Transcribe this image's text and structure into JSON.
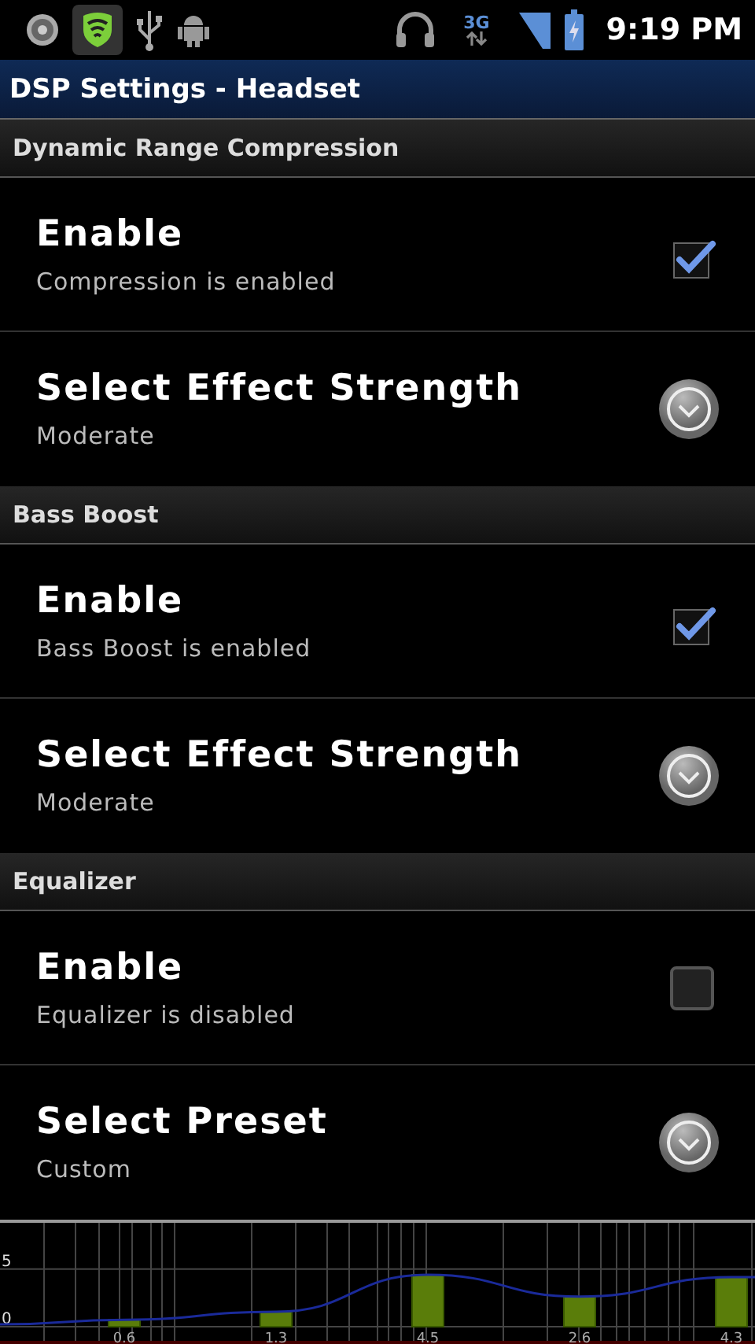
{
  "status_bar": {
    "network": "3G",
    "time": "9:19 PM"
  },
  "title": "DSP Settings - Headset",
  "sections": [
    {
      "header": "Dynamic Range Compression",
      "items": [
        {
          "kind": "checkbox",
          "title": "Enable",
          "summary": "Compression is enabled",
          "checked": true
        },
        {
          "kind": "dropdown",
          "title": "Select Effect Strength",
          "summary": "Moderate"
        }
      ]
    },
    {
      "header": "Bass Boost",
      "items": [
        {
          "kind": "checkbox",
          "title": "Enable",
          "summary": "Bass Boost is enabled",
          "checked": true
        },
        {
          "kind": "dropdown",
          "title": "Select Effect Strength",
          "summary": "Moderate"
        }
      ]
    },
    {
      "header": "Equalizer",
      "items": [
        {
          "kind": "checkbox",
          "title": "Enable",
          "summary": "Equalizer is disabled",
          "checked": false
        },
        {
          "kind": "dropdown",
          "title": "Select Preset",
          "summary": "Custom"
        }
      ]
    }
  ],
  "equalizer_graph": {
    "chart_data": {
      "type": "bar",
      "values": [
        0.6,
        1.3,
        4.5,
        2.6,
        4.3
      ],
      "ylim": [
        0,
        9
      ],
      "yticks": [
        0,
        5
      ],
      "grid": true,
      "data_labels": true
    }
  }
}
